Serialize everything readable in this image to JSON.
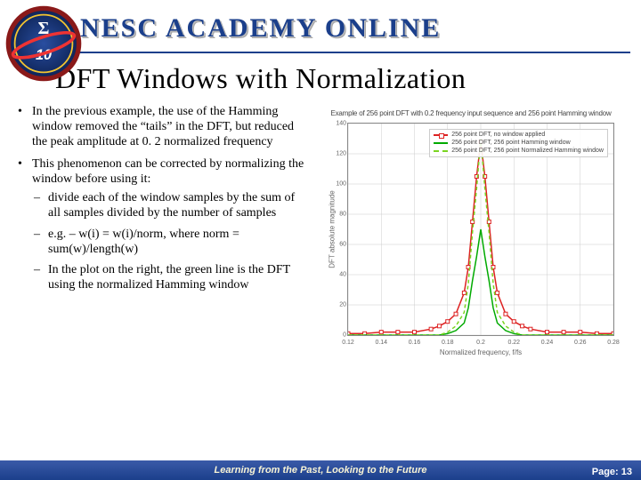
{
  "header": {
    "banner": "NESC ACADEMY ONLINE"
  },
  "title": "DFT Windows with Normalization",
  "bullets": {
    "items": [
      "In the previous example, the use of the Hamming window removed the “tails” in the DFT, but reduced the peak amplitude at 0. 2 normalized frequency",
      "This phenomenon can be corrected by normalizing the window before using it:"
    ],
    "sub": [
      "divide each of the window samples by the sum of all samples divided by the number of samples",
      "e.g. – w(i) = w(i)/norm, where norm = sum(w)/length(w)",
      "In the plot on the right, the green line is the DFT using the normalized Hamming window"
    ]
  },
  "chart_data": {
    "type": "line",
    "title": "Example of 256 point DFT with 0.2 frequency input sequence and 256 point Hamming window",
    "xlabel": "Normalized frequency, f/fs",
    "ylabel": "DFT absolute magnitude",
    "xlim": [
      0.12,
      0.28
    ],
    "ylim": [
      0,
      140
    ],
    "x_ticks": [
      0.12,
      0.14,
      0.16,
      0.18,
      0.2,
      0.22,
      0.24,
      0.26,
      0.28
    ],
    "y_ticks": [
      0,
      20,
      40,
      60,
      80,
      100,
      120,
      140
    ],
    "x": [
      0.12,
      0.13,
      0.14,
      0.15,
      0.16,
      0.17,
      0.175,
      0.18,
      0.185,
      0.19,
      0.1925,
      0.195,
      0.1975,
      0.2,
      0.2025,
      0.205,
      0.2075,
      0.21,
      0.215,
      0.22,
      0.225,
      0.23,
      0.24,
      0.25,
      0.26,
      0.27,
      0.28
    ],
    "series": [
      {
        "name": "256 point DFT, no window applied",
        "color": "#d22",
        "style": "line-square",
        "values": [
          1,
          1,
          2,
          2,
          2,
          4,
          6,
          9,
          14,
          28,
          45,
          75,
          105,
          128,
          105,
          75,
          45,
          28,
          14,
          9,
          6,
          4,
          2,
          2,
          2,
          1,
          1
        ]
      },
      {
        "name": "256 point DFT, 256 point Hamming window",
        "color": "#0a0",
        "style": "line",
        "values": [
          0,
          0,
          0,
          0,
          0,
          0,
          0,
          1,
          3,
          8,
          18,
          36,
          52,
          70,
          52,
          36,
          18,
          8,
          3,
          1,
          0,
          0,
          0,
          0,
          0,
          0,
          0
        ]
      },
      {
        "name": "256 point DFT, 256 point Normalized Hamming window",
        "color": "#7bd421",
        "style": "dashed",
        "values": [
          0,
          0,
          0,
          0,
          0,
          0,
          0,
          2,
          6,
          15,
          34,
          68,
          97,
          130,
          97,
          68,
          34,
          15,
          6,
          2,
          0,
          0,
          0,
          0,
          0,
          0,
          0
        ]
      }
    ],
    "legend_position": "top-right",
    "grid": true
  },
  "footer": {
    "text": "Learning from the Past, Looking to the Future",
    "page": "Page: 13"
  }
}
